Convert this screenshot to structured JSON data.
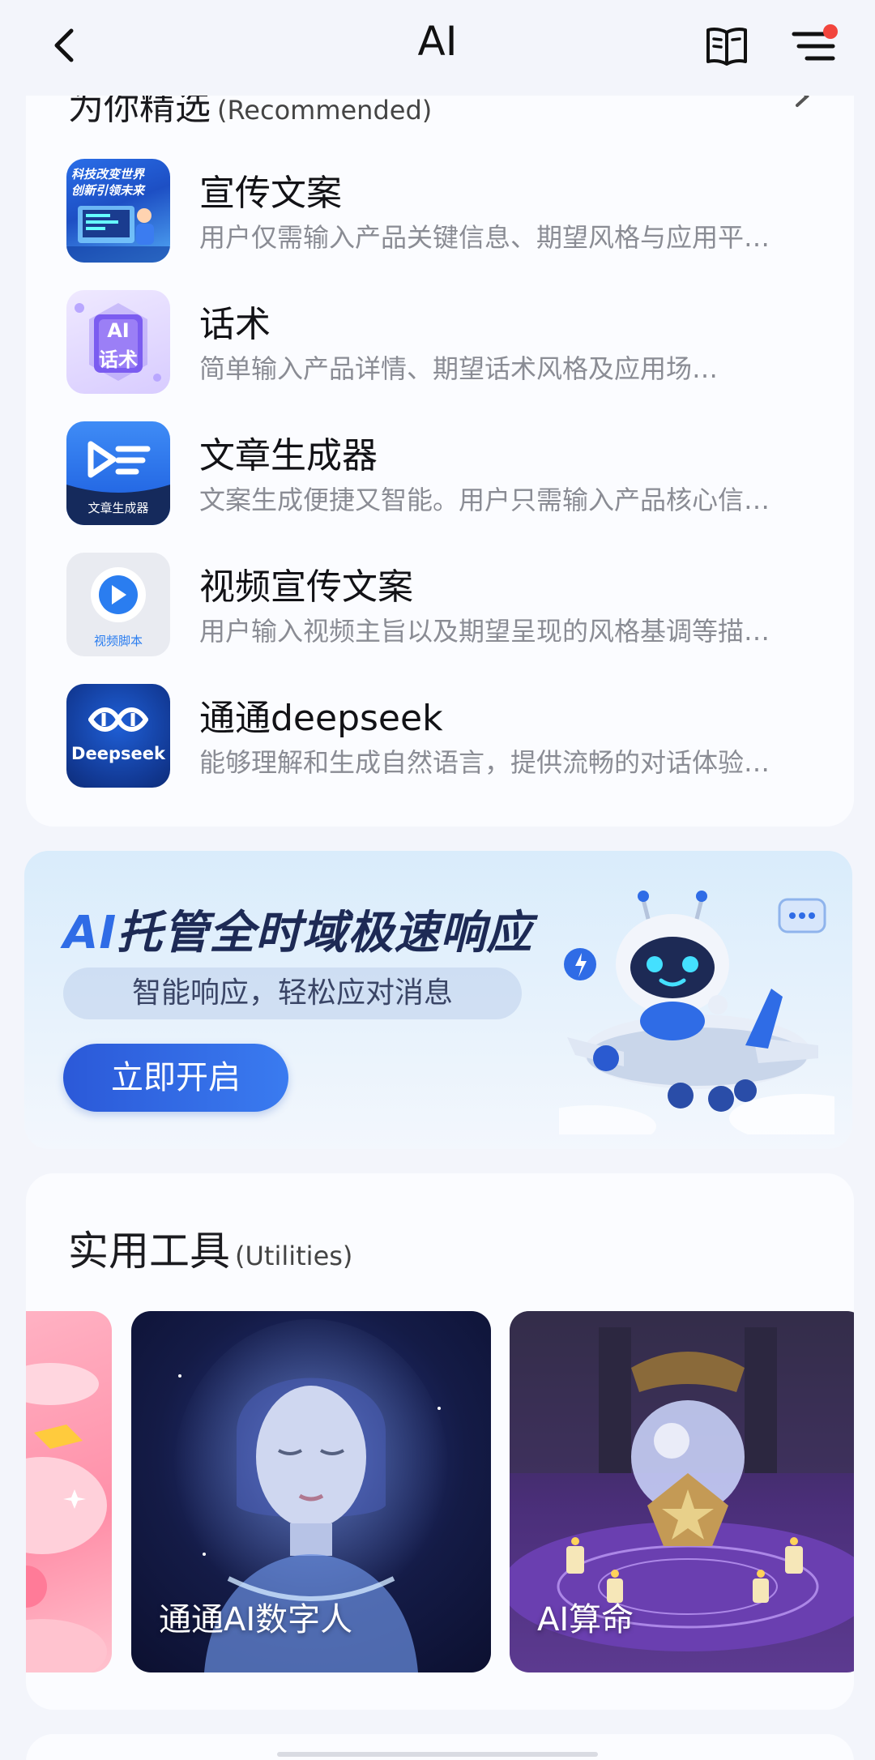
{
  "header": {
    "title": "AI"
  },
  "recommended": {
    "title": "为你精选",
    "title_en": "(Recommended)",
    "items": [
      {
        "title": "宣传文案",
        "desc": "用户仅需输入产品关键信息、期望风格与应用平…",
        "icon": "promo-copy-icon",
        "icon_text_1": "科技改变世界",
        "icon_text_2": "创新引领未来"
      },
      {
        "title": "话术",
        "desc": "简单输入产品详情、期望话术风格及应用场…",
        "icon": "ai-script-icon",
        "icon_text_1": "AI",
        "icon_text_2": "话术"
      },
      {
        "title": "文章生成器",
        "desc": "文案生成便捷又智能。用户只需输入产品核心信…",
        "icon": "article-generator-icon",
        "icon_text_1": "文章生成器"
      },
      {
        "title": "视频宣传文案",
        "desc": "用户输入视频主旨以及期望呈现的风格基调等描…",
        "icon": "video-script-icon",
        "icon_text_1": "视频脚本"
      },
      {
        "title": "通通deepseek",
        "desc": "能够理解和生成自然语言，提供流畅的对话体验…",
        "icon": "deepseek-icon",
        "icon_text_1": "Deepseek"
      }
    ]
  },
  "banner": {
    "title_ai": "AI",
    "title_rest": "托管全时域极速响应",
    "subtitle": "智能响应，轻松应对消息",
    "button": "立即开启"
  },
  "utilities": {
    "title": "实用工具",
    "title_en": "(Utilities)",
    "tools": [
      {
        "label": "",
        "icon": "pink-art-card"
      },
      {
        "label": "通通AI数字人",
        "icon": "digital-human-card"
      },
      {
        "label": "AI算命",
        "icon": "fortune-telling-card"
      }
    ]
  },
  "colors": {
    "accent": "#2f6ce6",
    "background": "#f3f5fb",
    "card": "#fbfcff",
    "badge": "#f2453d"
  }
}
